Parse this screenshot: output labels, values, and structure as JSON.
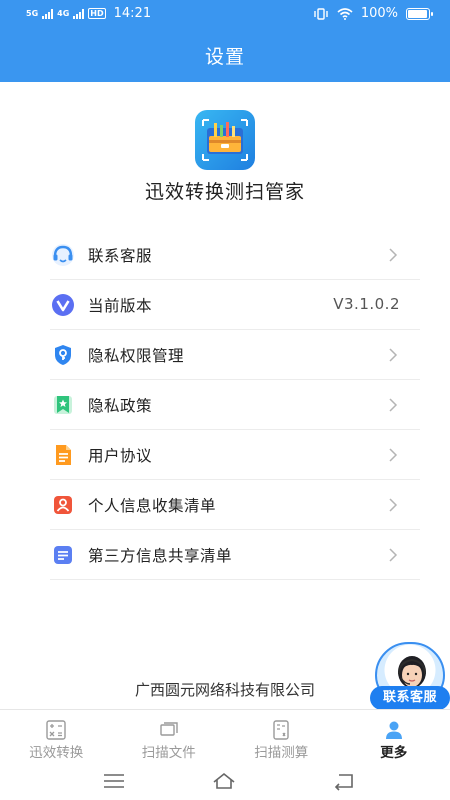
{
  "status_bar": {
    "network_left": "5G",
    "network_right": "4G",
    "hd": "HD",
    "time": "14:21",
    "battery_text": "100%",
    "battery_level": 1.0
  },
  "header": {
    "title": "设置"
  },
  "app": {
    "name": "迅效转换测扫管家",
    "logo_icon": "toolbox-icon"
  },
  "settings": [
    {
      "label": "联系客服",
      "icon": "headset-icon",
      "color": "#3a8ff0"
    },
    {
      "label": "当前版本",
      "icon": "version-v-icon",
      "color": "#4b6cf0",
      "value": "V3.1.0.2"
    },
    {
      "label": "隐私权限管理",
      "icon": "shield-key-icon",
      "color": "#2f86f0"
    },
    {
      "label": "隐私政策",
      "icon": "bookmark-star-icon",
      "color": "#2fc47c"
    },
    {
      "label": "用户协议",
      "icon": "document-icon",
      "color": "#ff9a1f"
    },
    {
      "label": "个人信息收集清单",
      "icon": "person-card-icon",
      "color": "#f0553a"
    },
    {
      "label": "第三方信息共享清单",
      "icon": "list-doc-icon",
      "color": "#4f7cf0"
    }
  ],
  "company": "广西圆元网络科技有限公司",
  "float_service": {
    "label": "联系客服",
    "icon": "customer-service-avatar-icon"
  },
  "tabs": [
    {
      "label": "迅效转换",
      "icon": "calculator-icon",
      "active": false
    },
    {
      "label": "扫描文件",
      "icon": "scan-file-icon",
      "active": false
    },
    {
      "label": "扫描测算",
      "icon": "measure-icon",
      "active": false
    },
    {
      "label": "更多",
      "icon": "person-icon",
      "active": true
    }
  ],
  "colors": {
    "primary": "#3a96f0",
    "accent": "#1e7ff0"
  }
}
